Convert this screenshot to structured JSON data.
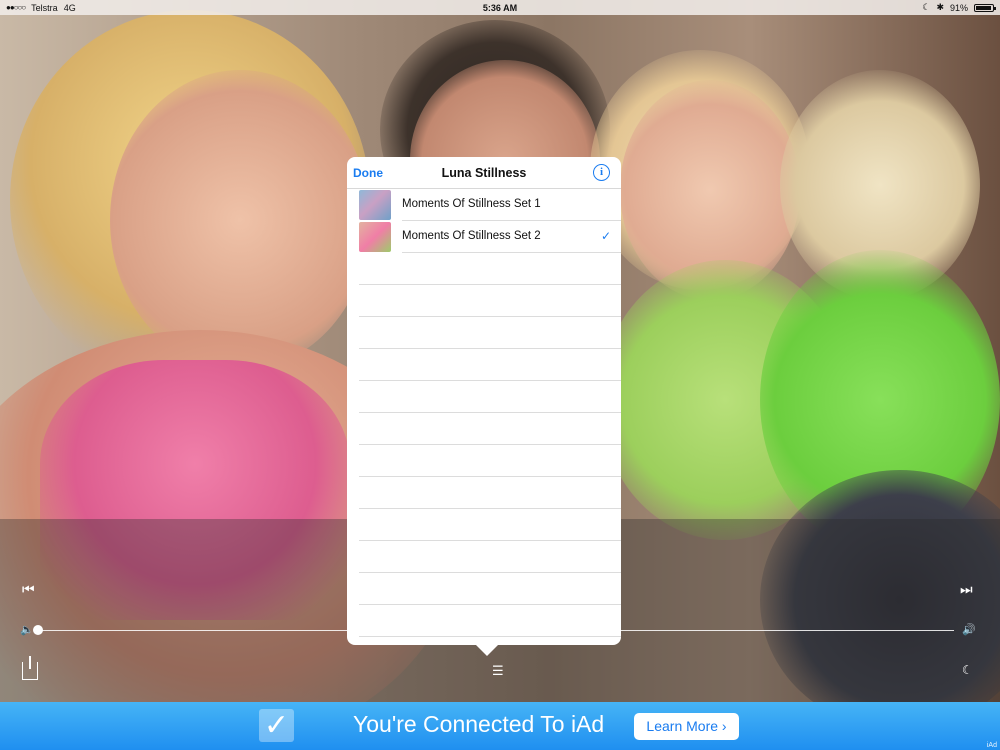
{
  "status_bar": {
    "signal": "●●○○○",
    "carrier": "Telstra",
    "network": "4G",
    "time": "5:36 AM",
    "moon_icon": "☾",
    "bluetooth_icon": "✱",
    "battery": "91%",
    "battery_level": 0.91
  },
  "player": {
    "prev_icon": "⏮",
    "next_icon": "⏭",
    "volume_low_icon": "🔈",
    "volume_high_icon": "🔊",
    "volume_level": 0.0,
    "list_icon": "☰",
    "moon_icon": "☾"
  },
  "popover": {
    "done_label": "Done",
    "title": "Luna Stillness",
    "info_icon": "i",
    "items": [
      {
        "label": "Moments Of Stillness Set 1",
        "selected": false
      },
      {
        "label": "Moments Of Stillness Set 2",
        "selected": true,
        "check": "✓"
      }
    ],
    "empty_rows": 12
  },
  "ad": {
    "check_icon": "✓",
    "text": "You're Connected To iAd",
    "button_label": "Learn More ›",
    "badge": "iAd"
  },
  "colors": {
    "accent": "#1a7cf0",
    "ad_top": "#46b4f6",
    "ad_bottom": "#1f8ff0"
  }
}
